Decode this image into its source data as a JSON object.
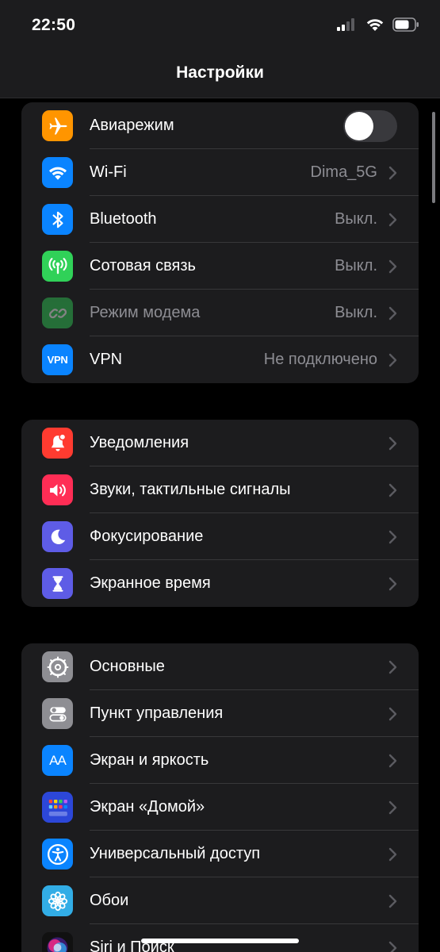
{
  "status_bar": {
    "time": "22:50",
    "icons": [
      "cellular-signal-icon",
      "wifi-icon",
      "battery-icon"
    ]
  },
  "nav": {
    "title": "Настройки"
  },
  "groups": [
    {
      "items": [
        {
          "id": "airplane",
          "label": "Авиарежим",
          "icon": "airplane-icon",
          "icon_color": "#ff9500",
          "control": "toggle",
          "toggle_on": false
        },
        {
          "id": "wifi",
          "label": "Wi-Fi",
          "value": "Dima_5G",
          "icon": "wifi-icon",
          "icon_color": "#0a84ff"
        },
        {
          "id": "bluetooth",
          "label": "Bluetooth",
          "value": "Выкл.",
          "icon": "bluetooth-icon",
          "icon_color": "#0a84ff"
        },
        {
          "id": "cellular",
          "label": "Сотовая связь",
          "value": "Выкл.",
          "icon": "antenna-icon",
          "icon_color": "#30d158"
        },
        {
          "id": "hotspot",
          "label": "Режим модема",
          "value": "Выкл.",
          "icon": "chain-link-icon",
          "icon_color": "#30d158",
          "disabled": true
        },
        {
          "id": "vpn",
          "label": "VPN",
          "value": "Не подключено",
          "icon": "vpn-icon",
          "icon_text": "VPN",
          "icon_color": "#0a84ff"
        }
      ]
    },
    {
      "items": [
        {
          "id": "notifications",
          "label": "Уведомления",
          "icon": "bell-icon",
          "icon_color": "#ff3b30"
        },
        {
          "id": "sounds",
          "label": "Звуки, тактильные сигналы",
          "icon": "speaker-icon",
          "icon_color": "#ff2d55"
        },
        {
          "id": "focus",
          "label": "Фокусирование",
          "icon": "moon-icon",
          "icon_color": "#5e5ce6"
        },
        {
          "id": "screen-time",
          "label": "Экранное время",
          "icon": "hourglass-icon",
          "icon_color": "#5e5ce6"
        }
      ]
    },
    {
      "items": [
        {
          "id": "general",
          "label": "Основные",
          "icon": "gear-icon",
          "icon_color": "#8e8e93"
        },
        {
          "id": "control-center",
          "label": "Пункт управления",
          "icon": "switches-icon",
          "icon_color": "#8e8e93"
        },
        {
          "id": "display",
          "label": "Экран и яркость",
          "icon": "text-size-icon",
          "icon_text": "AA",
          "icon_color": "#0a84ff"
        },
        {
          "id": "home-screen",
          "label": "Экран «Домой»",
          "icon": "app-grid-icon",
          "icon_color": "#2c47d8"
        },
        {
          "id": "accessibility",
          "label": "Универсальный доступ",
          "icon": "accessibility-icon",
          "icon_color": "#0a84ff"
        },
        {
          "id": "wallpaper",
          "label": "Обои",
          "icon": "flower-icon",
          "icon_color": "#32ade6"
        },
        {
          "id": "siri",
          "label": "Siri и Поиск",
          "icon": "siri-icon",
          "icon_color": "#1c1c1e"
        }
      ]
    }
  ]
}
